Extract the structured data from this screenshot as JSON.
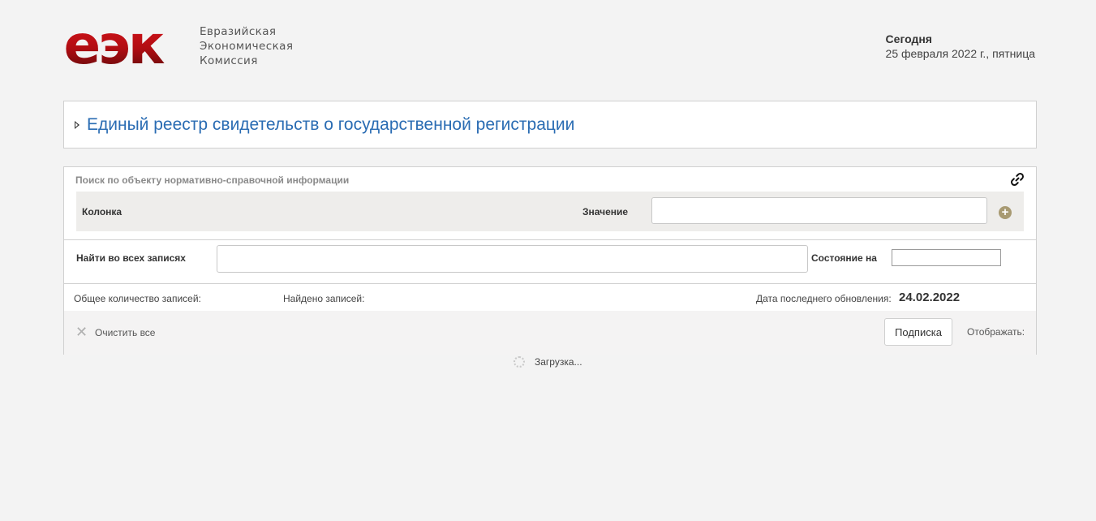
{
  "header": {
    "logo_mark": "еэк",
    "logo_line1": "Евразийская",
    "logo_line2": "Экономическая",
    "logo_line3": "Комиссия",
    "today_label": "Сегодня",
    "today_date": "25 февраля 2022 г., пятница"
  },
  "title_panel": {
    "title": "Единый реестр свидетельств о государственной регистрации"
  },
  "search": {
    "caption": "Поиск по объекту нормативно-справочной информации",
    "column_label": "Колонка",
    "value_label": "Значение",
    "value_input": "",
    "find_all_label": "Найти во всех записях",
    "find_all_input": "",
    "state_label": "Состояние на",
    "state_input": ""
  },
  "stats": {
    "total_label": "Общее количество записей:",
    "found_label": "Найдено записей:",
    "updated_label": "Дата последнего обновления:",
    "updated_date": "24.02.2022"
  },
  "actions": {
    "clear_all": "Очистить все",
    "subscribe": "Подписка",
    "display": "Отображать:"
  },
  "loading": {
    "text": "Загрузка..."
  },
  "colors": {
    "brand_red": "#c0111a",
    "title_blue": "#2a6cb3",
    "plus_gold": "#a89a72"
  },
  "icons": {
    "expand": "triangle-right-icon",
    "link": "link-icon",
    "add": "plus-circle-icon",
    "clear": "x-icon",
    "spinner": "spinner-icon"
  }
}
